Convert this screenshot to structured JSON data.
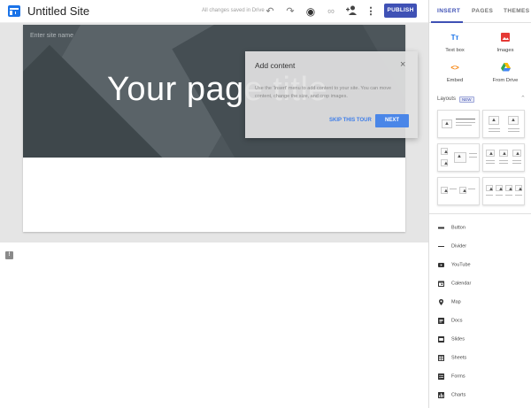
{
  "topbar": {
    "title": "Untitled Site",
    "saved_status": "All changes saved in Drive",
    "publish_label": "PUBLISH"
  },
  "page": {
    "site_name_placeholder": "Enter site name",
    "title": "Your page title"
  },
  "popup": {
    "title": "Add content",
    "close": "×",
    "text": "Use the 'Insert' menu to add content to your site. You can move content, change the size, and crop images.",
    "skip_label": "SKIP THIS TOUR",
    "next_label": "NEXT"
  },
  "side": {
    "tabs": [
      "INSERT",
      "PAGES",
      "THEMES"
    ],
    "insert_items": [
      {
        "label": "Text box",
        "icon": "text-box-icon"
      },
      {
        "label": "Images",
        "icon": "image-icon"
      },
      {
        "label": "Embed",
        "icon": "embed-icon"
      },
      {
        "label": "From Drive",
        "icon": "drive-icon"
      }
    ],
    "layouts_label": "Layouts",
    "new_badge": "NEW",
    "elements": [
      {
        "label": "Button",
        "icon": "button-icon"
      },
      {
        "label": "Divider",
        "icon": "divider-icon"
      },
      {
        "label": "YouTube",
        "icon": "youtube-icon"
      },
      {
        "label": "Calendar",
        "icon": "calendar-icon"
      },
      {
        "label": "Map",
        "icon": "map-icon"
      },
      {
        "label": "Docs",
        "icon": "docs-icon"
      },
      {
        "label": "Slides",
        "icon": "slides-icon"
      },
      {
        "label": "Sheets",
        "icon": "sheets-icon"
      },
      {
        "label": "Forms",
        "icon": "forms-icon"
      },
      {
        "label": "Charts",
        "icon": "charts-icon"
      }
    ]
  },
  "colors": {
    "accent": "#3f51b5",
    "hero": "#4d565b",
    "next_button": "#4a86e8"
  }
}
